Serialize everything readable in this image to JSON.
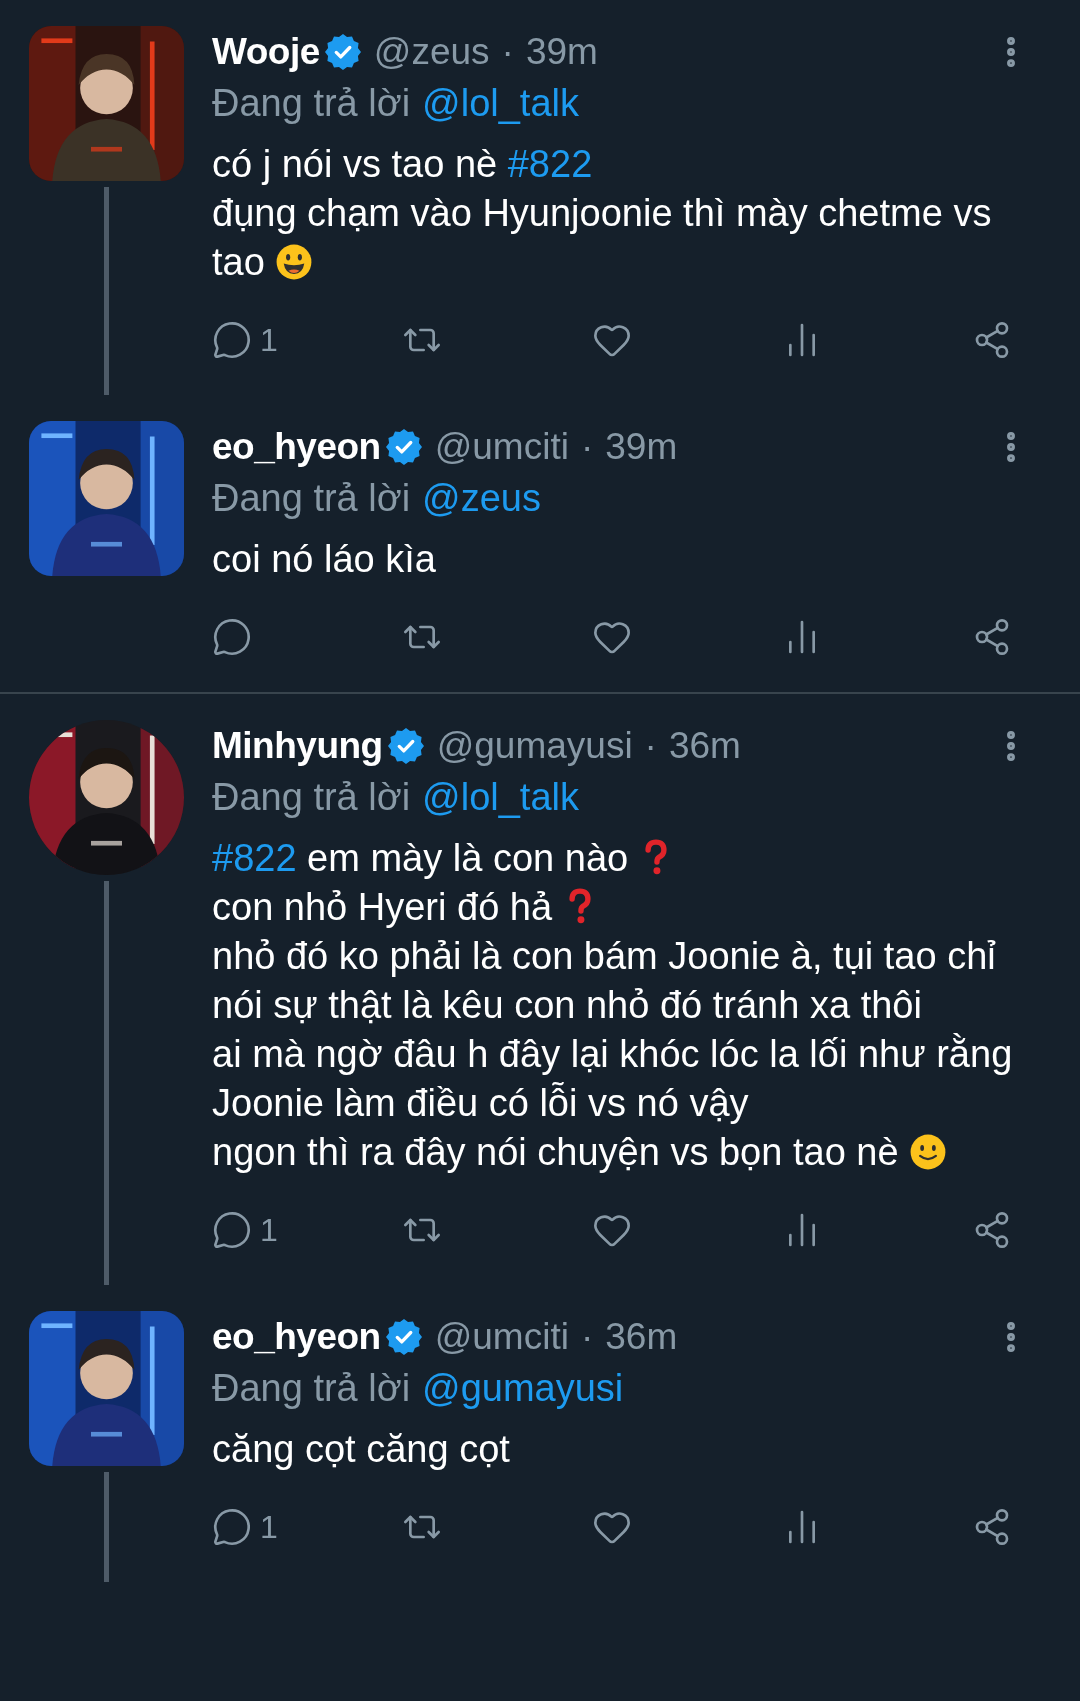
{
  "tweets": [
    {
      "name": "Wooje",
      "verified": true,
      "handle": "@zeus",
      "separator": "·",
      "time": "39m",
      "avatar": {
        "kind": "picture"
      },
      "avatar_round": false,
      "thread_line": true,
      "reply_prefix": "Đang trả lời",
      "reply_to": "@lol_talk",
      "body": [
        [
          {
            "kind": "text",
            "text": "có j nói vs tao nè "
          },
          {
            "kind": "hashtag",
            "text": "#822"
          }
        ],
        [
          {
            "kind": "text",
            "text": "đụng chạm vào Hyunjoonie thì mày chetme vs tao "
          },
          {
            "kind": "grin"
          }
        ]
      ],
      "reply_count": "1"
    },
    {
      "name": "eo_hyeon",
      "verified": true,
      "handle": "@umciti",
      "separator": "·",
      "time": "39m",
      "avatar": {
        "kind": "picture"
      },
      "avatar_round": false,
      "thread_line": false,
      "reply_prefix": "Đang trả lời",
      "reply_to": "@zeus",
      "body": [
        [
          {
            "kind": "text",
            "text": "coi nó láo kìa"
          }
        ]
      ],
      "divider_after": true
    },
    {
      "name": "Minhyung",
      "verified": true,
      "handle": "@gumayusi",
      "separator": "·",
      "time": "36m",
      "avatar": {
        "kind": "picture"
      },
      "avatar_round": true,
      "thread_line": true,
      "reply_prefix": "Đang trả lời",
      "reply_to": "@lol_talk",
      "body": [
        [
          {
            "kind": "hashtag",
            "text": "#822"
          },
          {
            "kind": "text",
            "text": " em mày là con nào "
          },
          {
            "kind": "question"
          }
        ],
        [
          {
            "kind": "text",
            "text": "con nhỏ Hyeri đó hả "
          },
          {
            "kind": "question"
          }
        ],
        [
          {
            "kind": "text",
            "text": "nhỏ đó ko phải là con bám Joonie à, tụi tao chỉ nói sự thật là kêu con nhỏ đó tránh xa thôi"
          }
        ],
        [
          {
            "kind": "text",
            "text": "ai mà ngờ đâu h đây lại khóc lóc la lối như rằng Joonie làm điều có lỗi vs nó vậy"
          }
        ],
        [
          {
            "kind": "text",
            "text": "ngon thì ra đây nói chuyện vs bọn tao nè "
          },
          {
            "kind": "smile"
          }
        ]
      ],
      "reply_count": "1"
    },
    {
      "name": "eo_hyeon",
      "verified": true,
      "handle": "@umciti",
      "separator": "·",
      "time": "36m",
      "avatar": {
        "kind": "picture"
      },
      "avatar_round": false,
      "thread_line": true,
      "reply_prefix": "Đang trả lời",
      "reply_to": "@gumayusi",
      "body": [
        [
          {
            "kind": "text",
            "text": "căng cọt căng cọt"
          }
        ]
      ],
      "reply_count": "1"
    }
  ]
}
